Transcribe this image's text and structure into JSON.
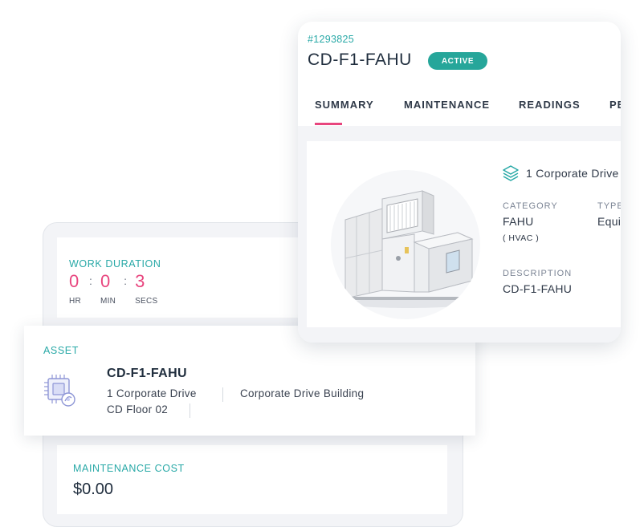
{
  "work_order": {
    "duration": {
      "label": "WORK DURATION",
      "hours": "0",
      "minutes": "0",
      "seconds": "3",
      "hours_unit": "HR",
      "minutes_unit": "MIN",
      "seconds_unit": "SECS",
      "separator": ":"
    },
    "cost": {
      "label": "MAINTENANCE COST",
      "value": "$0.00"
    }
  },
  "asset_card": {
    "label": "ASSET",
    "name": "CD-F1-FAHU",
    "site": "1 Corporate Drive",
    "building": "Corporate Drive Building",
    "floor": "CD Floor 02",
    "icon": "equipment-chip-icon"
  },
  "asset_detail": {
    "id": "#1293825",
    "title": "CD-F1-FAHU",
    "status": "ACTIVE",
    "tabs": [
      {
        "label": "SUMMARY",
        "active": true
      },
      {
        "label": "MAINTENANCE",
        "active": false
      },
      {
        "label": "READINGS",
        "active": false
      },
      {
        "label": "PE",
        "active": false
      }
    ],
    "location": "1 Corporate Drive",
    "location_icon": "layers-icon",
    "fields": {
      "category_label": "CATEGORY",
      "category_value": "FAHU",
      "category_sub": "( HVAC )",
      "type_label": "TYPE",
      "type_value": "Equi",
      "description_label": "DESCRIPTION",
      "description_value": "CD-F1-FAHU"
    },
    "image": "air-handling-unit-photo"
  },
  "colors": {
    "teal": "#29a9a7",
    "pink": "#e8457e",
    "badge": "#26a69a",
    "text": "#1f2d3d",
    "panel_bg": "#f3f4f7"
  }
}
